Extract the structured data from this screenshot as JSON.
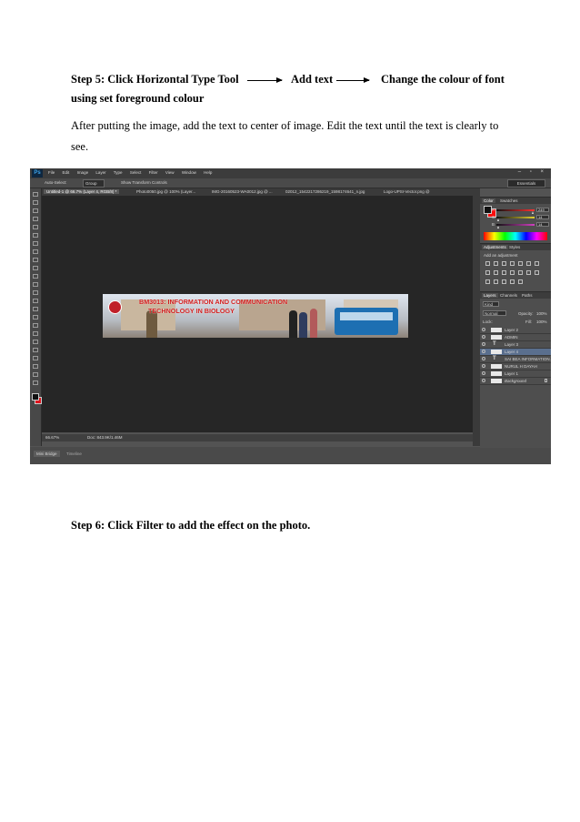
{
  "step5": {
    "part1": "Step 5: Click Horizontal Type Tool",
    "part2": "Add text",
    "part3": "Change the colour of font",
    "line2": "using set foreground colour"
  },
  "paragraph": {
    "line1": "After putting the image, add the text to center of image. Edit the text until the text is clearly to",
    "line2": "see."
  },
  "step6": "Step 6: Click Filter to add the effect on the photo.",
  "photoshop": {
    "logo": "Ps",
    "menus": [
      "File",
      "Edit",
      "Image",
      "Layer",
      "Type",
      "Select",
      "Filter",
      "View",
      "Window",
      "Help"
    ],
    "window_controls": "– ▫ ×",
    "options": {
      "auto_select": "Auto-Select:",
      "group": "Group",
      "show_transform": "Show Transform Controls",
      "workspace": "Essentials"
    },
    "doc_tabs": [
      "Untitled-1 @ 66.7% (Layer 4, RGB/8) *",
      "Photo0050.jpg @ 100% (Layer...",
      "IMG-20160523-WA0012.jpg @ ...",
      "02012_1542217286219_1598174641_n.jpg",
      "Logo-UPSI-Vector.png @"
    ],
    "status": {
      "zoom": "66.67%",
      "doc": "Doc: 843.9K/1.46M"
    },
    "bottom_tabs": [
      "Mini Bridge",
      "Timeline"
    ],
    "banner": {
      "line1": "BM3013: INFORMATION AND COMMUNICATION",
      "line2": "TECHNOLOGY IN BIOLOGY"
    },
    "color_panel": {
      "tabs": [
        "Color",
        "Swatches"
      ],
      "channels": [
        {
          "label": "R",
          "value": "249",
          "fraction": 0.976,
          "bar": "#ff3030"
        },
        {
          "label": "G",
          "value": "14",
          "fraction": 0.055,
          "bar": "#e0d030"
        },
        {
          "label": "B",
          "value": "14",
          "fraction": 0.055,
          "bar": "#d040c0"
        }
      ],
      "foreground": "#f90e0e"
    },
    "adjustments_panel": {
      "tabs": [
        "Adjustments",
        "Styles"
      ],
      "heading": "Add an adjustment"
    },
    "layers_panel": {
      "tabs": [
        "Layers",
        "Channels",
        "Paths"
      ],
      "filter": "Kind",
      "blend": "Normal",
      "opacity_label": "Opacity:",
      "opacity": "100%",
      "lock_label": "Lock:",
      "fill_label": "Fill:",
      "fill": "100%",
      "layers": [
        {
          "name": "Layer 2",
          "type": "image",
          "selected": false
        },
        {
          "name": "ADMIN",
          "type": "image",
          "selected": false
        },
        {
          "name": "Layer 3",
          "type": "text",
          "selected": false
        },
        {
          "name": "Layer 4",
          "type": "image",
          "selected": true
        },
        {
          "name": "SAI BEA INFORMATION A...",
          "type": "text",
          "selected": false
        },
        {
          "name": "NURUL H DAYAH",
          "type": "image",
          "selected": false
        },
        {
          "name": "Layer 1",
          "type": "image",
          "selected": false
        },
        {
          "name": "Background",
          "type": "image",
          "selected": false
        }
      ]
    }
  }
}
